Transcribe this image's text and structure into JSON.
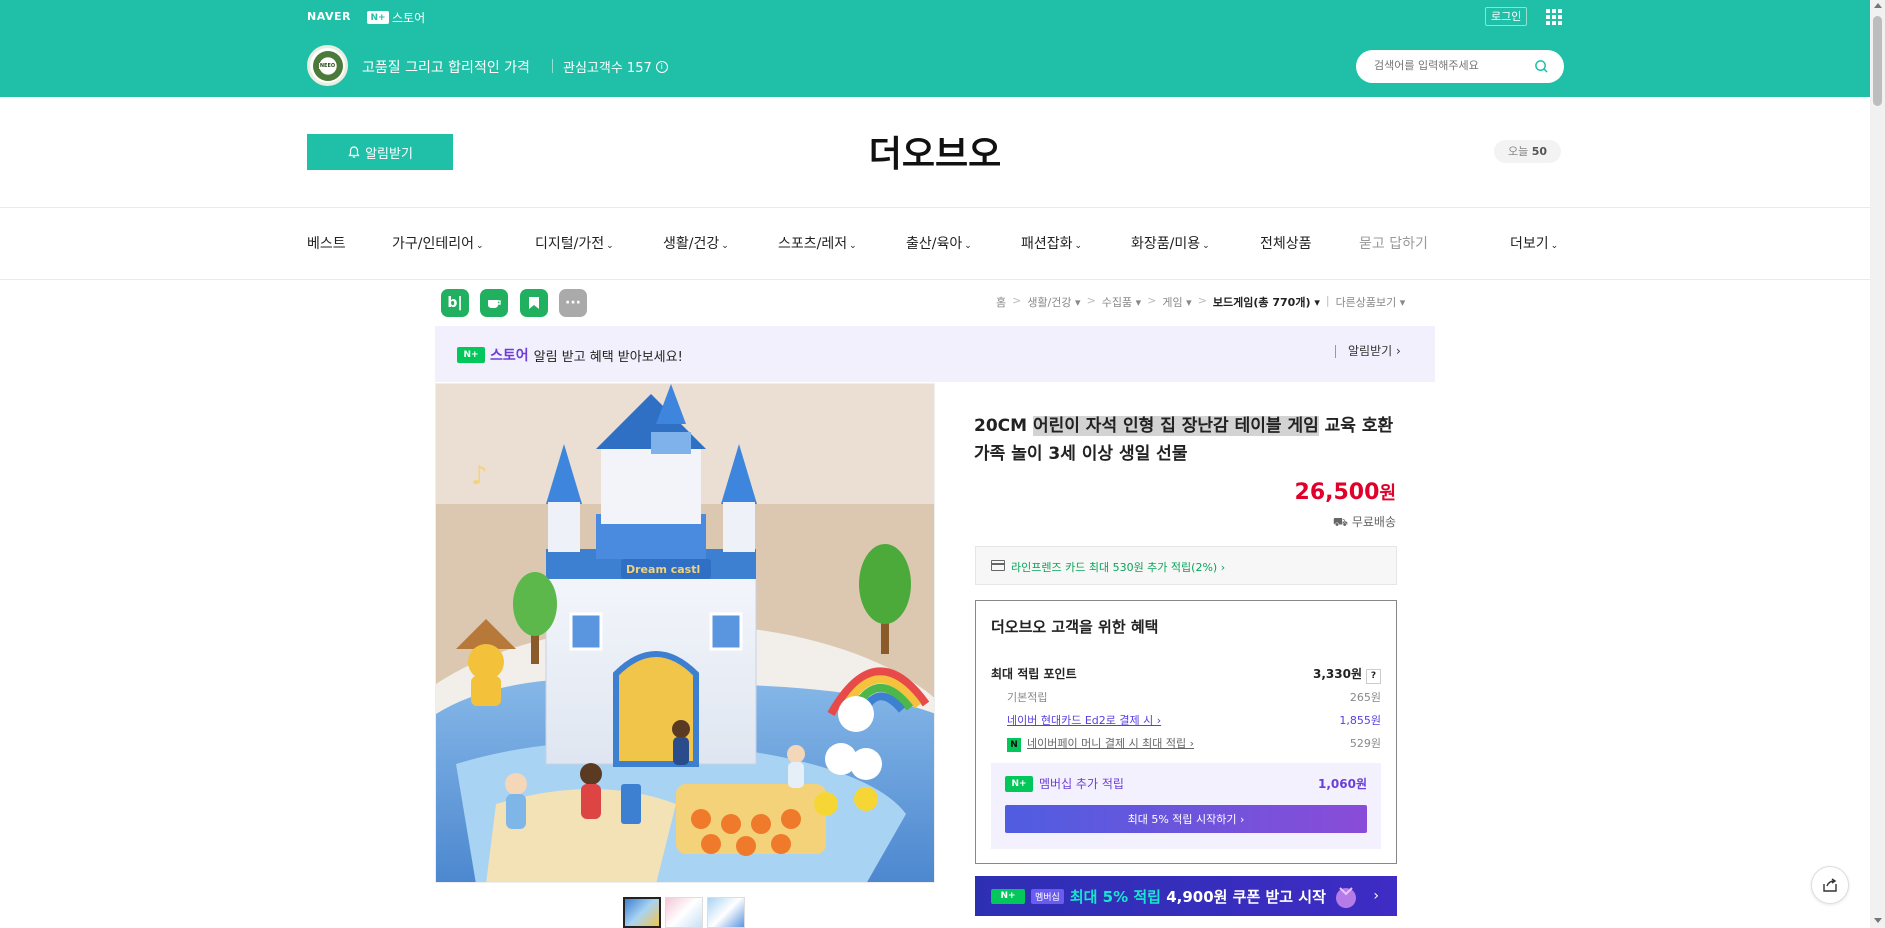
{
  "topbar": {
    "naver": "NAVER",
    "nplus_badge": "N+",
    "store_label": "스토어",
    "login": "로그인"
  },
  "storebar": {
    "logo_text": "NEEO",
    "slogan": "고품질 그리고 합리적인 가격",
    "interest_label": "관심고객수 157",
    "search_placeholder": "검색어를 입력해주세요"
  },
  "header": {
    "alarm_button": "알림받기",
    "store_name": "더오브오",
    "today_label": "오늘",
    "today_count": "50"
  },
  "nav": {
    "items": [
      {
        "label": "베스트",
        "chevron": ""
      },
      {
        "label": "가구/인테리어",
        "chevron": "⌄"
      },
      {
        "label": "디지털/가전",
        "chevron": "⌄"
      },
      {
        "label": "생활/건강",
        "chevron": "⌄"
      },
      {
        "label": "스포츠/레저",
        "chevron": "⌄"
      },
      {
        "label": "출산/육아",
        "chevron": "⌄"
      },
      {
        "label": "패션잡화",
        "chevron": "⌄"
      },
      {
        "label": "화장품/미용",
        "chevron": "⌄"
      },
      {
        "label": "전체상품",
        "chevron": ""
      },
      {
        "label": "묻고 답하기",
        "chevron": ""
      },
      {
        "label": "더보기",
        "chevron": "⌄"
      }
    ]
  },
  "channels": {
    "blog": "b|",
    "more": "···"
  },
  "breadcrumb": {
    "home": "홈",
    "c1": "생활/건강",
    "c2": "수집품",
    "c3": "게임",
    "c4": "보드게임(총 770개)",
    "other": "다른상품보기"
  },
  "promo": {
    "badge": "N+",
    "store": "스토어",
    "text": "알림 받고 혜택 받아보세요!",
    "right": "알림받기 ›"
  },
  "product": {
    "title_prefix": "20CM ",
    "title_highlight": "어린이 자석 인형 집 장난감 테이블 게임",
    "title_suffix": " 교육 호환 가족 놀이 3세 이상 생일 선물",
    "price": "26,500",
    "price_unit": "원",
    "shipping": "무료배송",
    "castle_sign": "Dream castl"
  },
  "card_benefit": "라인프렌즈 카드 최대 530원 추가 적립(2%) ›",
  "benefits": {
    "title": "더오브오 고객을 위한 혜택",
    "max_label": "최대 적립 포인트",
    "max_value": "3,330원",
    "q": "?",
    "rows": [
      {
        "label": "기본적립",
        "value": "265원"
      },
      {
        "label": "네이버 현대카드 Ed2로 결제 시 ›",
        "value": "1,855원"
      },
      {
        "label": "네이버페이 머니 결제 시 최대 적립 ›",
        "value": "529원"
      }
    ],
    "npay_badge": "N",
    "member_badge": "N+",
    "member_label": "멤버십 추가 적립",
    "member_value": "1,060원",
    "member_button": "최대 5% 적립 시작하기 ›"
  },
  "bottom_banner": {
    "badge": "N+",
    "member_tag": "멤버십",
    "text_highlight": "최대 5% 적립",
    "text_rest": " 4,900원 쿠폰 받고 시작",
    "arrow": "›"
  },
  "colors": {
    "brand_green": "#20c0a8",
    "price_red": "#e0002a",
    "membership_purple": "#6b3fd6"
  }
}
